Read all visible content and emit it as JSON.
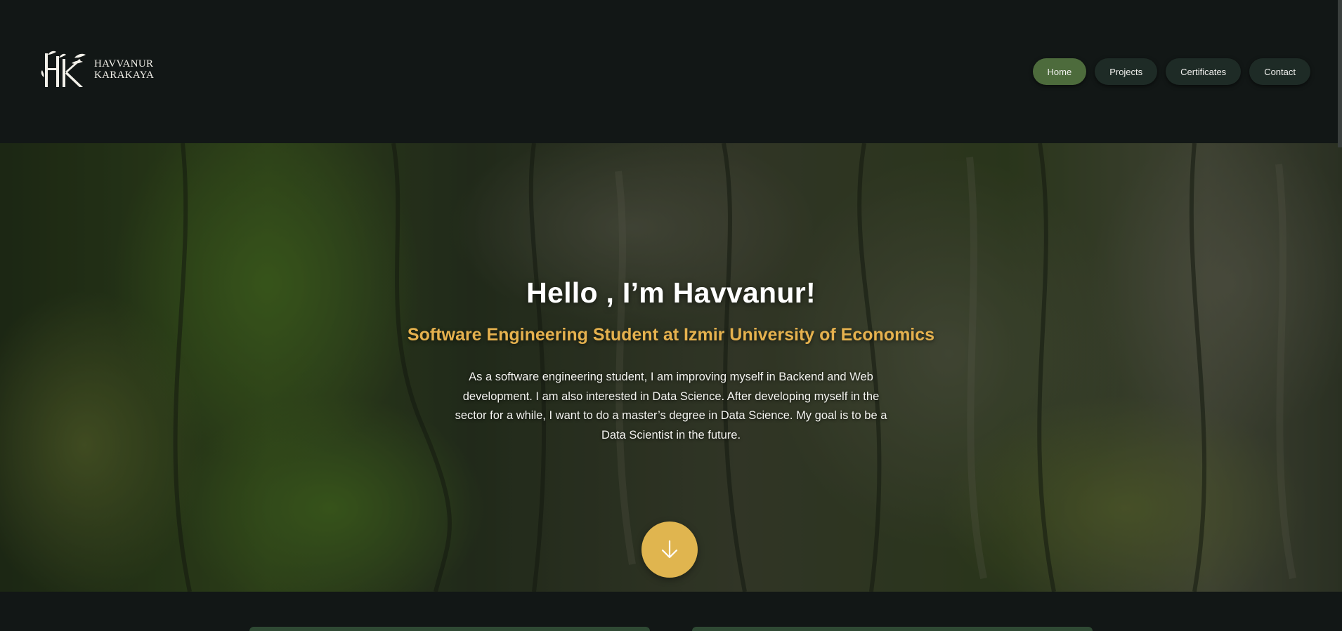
{
  "brand": {
    "line1": "HAVVANUR",
    "line2": "KARAKAYA",
    "monogram": "HK"
  },
  "nav": {
    "items": [
      {
        "label": "Home",
        "active": true
      },
      {
        "label": "Projects",
        "active": false
      },
      {
        "label": "Certificates",
        "active": false
      },
      {
        "label": "Contact",
        "active": false
      }
    ]
  },
  "hero": {
    "title": "Hello , I’m Havvanur!",
    "subtitle": "Software Engineering Student at Izmir University of Economics",
    "description": "As a software engineering student, I am improving myself in Backend and Web development. I am also interested in Data Science. After developing myself in the sector for a while, I want to do a master’s degree in Data Science. My goal is to be a Data Scientist in the future.",
    "scroll_icon": "arrow-down-icon"
  },
  "colors": {
    "background": "#121716",
    "nav_button": "#1e2b26",
    "nav_active": "#4d6b3c",
    "accent": "#e5b14e",
    "scroll_button": "#e0b54f"
  }
}
